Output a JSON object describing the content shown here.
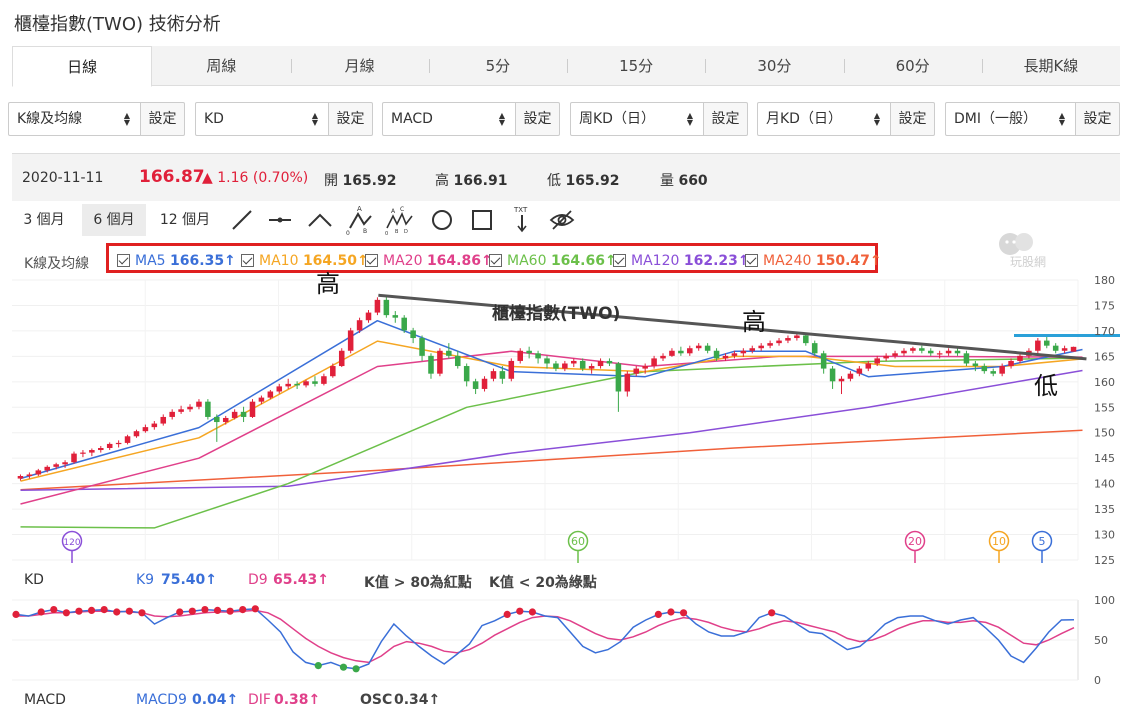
{
  "page_title": "櫃檯指數(TWO) 技術分析",
  "tabs": [
    {
      "label": "日線",
      "active": true
    },
    {
      "label": "周線"
    },
    {
      "label": "月線"
    },
    {
      "label": "5分"
    },
    {
      "label": "15分"
    },
    {
      "label": "30分"
    },
    {
      "label": "60分"
    },
    {
      "label": "長期K線"
    }
  ],
  "selects": [
    {
      "value": "K線及均線",
      "button": "設定"
    },
    {
      "value": "KD",
      "button": "設定"
    },
    {
      "value": "MACD",
      "button": "設定"
    },
    {
      "value": "周KD（日）",
      "button": "設定"
    },
    {
      "value": "月KD（日）",
      "button": "設定"
    },
    {
      "value": "DMI（一般）",
      "button": "設定"
    }
  ],
  "quote": {
    "date": "2020-11-11",
    "price": "166.87",
    "change": "1.16 (0.70%)",
    "open_label": "開",
    "open": "165.92",
    "high_label": "高",
    "high": "166.91",
    "low_label": "低",
    "low": "165.92",
    "volume_label": "量",
    "volume": "660"
  },
  "ranges": [
    {
      "label": "3 個月"
    },
    {
      "label": "6 個月",
      "active": true
    },
    {
      "label": "12 個月"
    }
  ],
  "tool_icons": [
    "line-tool-icon",
    "horizontal-line-icon",
    "peak-line-icon",
    "abc-pattern-icon",
    "abcde-pattern-icon",
    "circle-tool-icon",
    "rectangle-tool-icon",
    "text-tool-icon",
    "hide-drawings-icon"
  ],
  "ma_title": "K線及均線",
  "ma_items": [
    {
      "label": "MA5",
      "value": "166.35↑",
      "color": "#3a6fd8"
    },
    {
      "label": "MA10",
      "value": "164.50↑",
      "color": "#f5a623"
    },
    {
      "label": "MA20",
      "value": "164.86↑",
      "color": "#e0408a"
    },
    {
      "label": "MA60",
      "value": "164.66↑",
      "color": "#6cc04a"
    },
    {
      "label": "MA120",
      "value": "162.23↑",
      "color": "#8a4fd8"
    },
    {
      "label": "MA240",
      "value": "150.47↑",
      "color": "#f0603a"
    }
  ],
  "watermark": "玩股網",
  "annotations": {
    "high1": "高",
    "high2": "高",
    "low": "低",
    "trend_label": "櫃檯指數(TWO)"
  },
  "ma_markers": [
    {
      "label": "120",
      "color": "#8a4fd8"
    },
    {
      "label": "60",
      "color": "#6cc04a"
    },
    {
      "label": "20",
      "color": "#e0408a"
    },
    {
      "label": "10",
      "color": "#f5a623"
    },
    {
      "label": "5",
      "color": "#3a6fd8"
    }
  ],
  "kd": {
    "title": "KD",
    "k_label": "K9",
    "k_value": "75.40↑",
    "d_label": "D9",
    "d_value": "65.43↑",
    "note1": "K值 > 80為紅點",
    "note2": "K值 < 20為綠點"
  },
  "macd": {
    "title": "MACD",
    "macd_label": "MACD9",
    "macd_value": "0.04↑",
    "dif_label": "DIF",
    "dif_value": "0.38↑",
    "osc_label": "OSC",
    "osc_value": "0.34↑"
  },
  "colors": {
    "up": "#e0203a",
    "down": "#3aa84a",
    "trend": "#555555",
    "hline": "#2aa0d8"
  },
  "chart_data": [
    {
      "type": "candlestick",
      "title": "K線及均線",
      "ylim": [
        125,
        180
      ],
      "y_ticks": [
        125,
        130,
        135,
        140,
        145,
        150,
        155,
        160,
        165,
        170,
        175,
        180
      ],
      "candles": [
        [
          141.0,
          141.8,
          140.6,
          141.5
        ],
        [
          141.5,
          142.2,
          141.0,
          141.8
        ],
        [
          141.8,
          142.9,
          141.5,
          142.6
        ],
        [
          142.6,
          143.6,
          142.2,
          143.3
        ],
        [
          143.3,
          144.1,
          142.8,
          143.8
        ],
        [
          143.8,
          144.6,
          143.1,
          144.2
        ],
        [
          144.2,
          146.3,
          143.9,
          145.9
        ],
        [
          145.9,
          146.6,
          145.2,
          146.1
        ],
        [
          146.1,
          146.9,
          145.4,
          146.6
        ],
        [
          146.6,
          147.4,
          146.1,
          147.0
        ],
        [
          147.0,
          148.1,
          146.6,
          147.8
        ],
        [
          147.8,
          148.5,
          147.1,
          148.0
        ],
        [
          148.0,
          149.6,
          147.7,
          149.3
        ],
        [
          149.3,
          150.6,
          149.0,
          150.3
        ],
        [
          150.3,
          151.6,
          150.0,
          151.1
        ],
        [
          151.1,
          152.3,
          150.6,
          151.8
        ],
        [
          151.8,
          153.6,
          151.4,
          153.1
        ],
        [
          153.1,
          154.6,
          152.6,
          154.1
        ],
        [
          154.1,
          155.3,
          153.7,
          154.6
        ],
        [
          154.6,
          155.6,
          154.1,
          155.1
        ],
        [
          155.1,
          156.6,
          154.6,
          156.1
        ],
        [
          156.1,
          156.6,
          152.6,
          153.1
        ],
        [
          153.1,
          153.6,
          148.2,
          152.1
        ],
        [
          152.1,
          153.3,
          151.6,
          152.9
        ],
        [
          152.9,
          154.6,
          152.6,
          154.1
        ],
        [
          154.1,
          155.1,
          152.1,
          153.1
        ],
        [
          153.1,
          156.6,
          152.9,
          156.1
        ],
        [
          156.1,
          157.3,
          155.6,
          156.9
        ],
        [
          156.9,
          158.4,
          156.6,
          158.1
        ],
        [
          158.1,
          159.6,
          157.7,
          159.1
        ],
        [
          159.1,
          160.6,
          158.6,
          159.6
        ],
        [
          159.6,
          160.1,
          158.6,
          159.3
        ],
        [
          159.3,
          160.4,
          158.9,
          160.1
        ],
        [
          160.1,
          161.1,
          159.1,
          159.6
        ],
        [
          159.6,
          161.6,
          159.3,
          161.1
        ],
        [
          161.1,
          163.6,
          160.8,
          163.1
        ],
        [
          163.1,
          166.6,
          162.9,
          166.1
        ],
        [
          166.1,
          170.6,
          165.6,
          170.1
        ],
        [
          170.1,
          172.6,
          169.6,
          172.1
        ],
        [
          172.1,
          174.1,
          171.6,
          173.6
        ],
        [
          173.6,
          176.6,
          173.1,
          176.1
        ],
        [
          176.1,
          176.9,
          172.6,
          173.1
        ],
        [
          173.1,
          173.9,
          171.6,
          172.6
        ],
        [
          172.6,
          173.1,
          169.6,
          170.1
        ],
        [
          170.1,
          170.6,
          167.6,
          168.6
        ],
        [
          168.6,
          169.1,
          164.1,
          165.1
        ],
        [
          165.1,
          165.6,
          160.6,
          161.6
        ],
        [
          161.6,
          166.6,
          161.1,
          166.1
        ],
        [
          166.1,
          167.6,
          164.6,
          165.1
        ],
        [
          165.1,
          166.1,
          162.6,
          163.1
        ],
        [
          163.1,
          163.6,
          159.1,
          160.1
        ],
        [
          160.1,
          160.6,
          157.6,
          158.6
        ],
        [
          158.6,
          161.1,
          158.1,
          160.6
        ],
        [
          160.6,
          162.6,
          160.1,
          162.1
        ],
        [
          162.1,
          163.1,
          159.6,
          160.6
        ],
        [
          160.6,
          164.6,
          160.1,
          164.1
        ],
        [
          164.1,
          166.6,
          163.6,
          166.1
        ],
        [
          166.1,
          166.9,
          164.6,
          165.6
        ],
        [
          165.6,
          166.1,
          163.6,
          164.6
        ],
        [
          164.6,
          165.1,
          162.6,
          163.6
        ],
        [
          163.6,
          164.1,
          162.1,
          162.6
        ],
        [
          162.6,
          164.1,
          162.1,
          163.6
        ],
        [
          163.6,
          164.6,
          162.9,
          164.1
        ],
        [
          164.1,
          164.6,
          162.1,
          162.6
        ],
        [
          162.6,
          163.6,
          161.6,
          163.1
        ],
        [
          163.1,
          164.6,
          162.6,
          164.1
        ],
        [
          164.1,
          164.6,
          163.1,
          163.6
        ],
        [
          163.6,
          163.9,
          154.1,
          158.1
        ],
        [
          158.1,
          162.1,
          157.1,
          161.6
        ],
        [
          161.6,
          163.1,
          161.1,
          162.6
        ],
        [
          162.6,
          163.6,
          161.6,
          163.1
        ],
        [
          163.1,
          165.1,
          162.6,
          164.6
        ],
        [
          164.6,
          165.6,
          164.1,
          165.1
        ],
        [
          165.1,
          166.6,
          164.9,
          166.1
        ],
        [
          166.1,
          166.9,
          165.1,
          165.6
        ],
        [
          165.6,
          167.1,
          165.1,
          166.6
        ],
        [
          166.6,
          167.6,
          166.1,
          167.1
        ],
        [
          167.1,
          167.6,
          165.6,
          166.1
        ],
        [
          166.1,
          166.6,
          164.1,
          164.6
        ],
        [
          164.6,
          165.6,
          164.1,
          165.1
        ],
        [
          165.1,
          166.1,
          164.6,
          165.6
        ],
        [
          165.6,
          166.6,
          164.9,
          166.1
        ],
        [
          166.1,
          167.1,
          165.6,
          166.6
        ],
        [
          166.6,
          167.6,
          166.1,
          167.1
        ],
        [
          167.1,
          168.1,
          166.6,
          167.6
        ],
        [
          167.6,
          168.6,
          167.1,
          168.1
        ],
        [
          168.1,
          169.1,
          167.6,
          168.6
        ],
        [
          168.6,
          169.6,
          168.1,
          169.1
        ],
        [
          169.1,
          169.3,
          167.1,
          167.6
        ],
        [
          167.6,
          168.1,
          165.1,
          165.6
        ],
        [
          165.6,
          166.1,
          161.6,
          162.6
        ],
        [
          162.6,
          163.1,
          158.6,
          160.1
        ],
        [
          160.1,
          161.1,
          157.6,
          160.6
        ],
        [
          160.6,
          162.1,
          160.1,
          161.6
        ],
        [
          161.6,
          163.1,
          161.1,
          162.6
        ],
        [
          162.6,
          164.1,
          162.1,
          163.6
        ],
        [
          163.6,
          165.1,
          163.1,
          164.6
        ],
        [
          164.6,
          165.6,
          164.1,
          165.1
        ],
        [
          165.1,
          166.1,
          164.6,
          165.6
        ],
        [
          165.6,
          166.6,
          165.1,
          166.1
        ],
        [
          166.1,
          166.9,
          165.6,
          166.6
        ],
        [
          166.6,
          167.1,
          165.6,
          166.1
        ],
        [
          166.1,
          166.6,
          165.1,
          165.6
        ],
        [
          165.6,
          166.1,
          164.6,
          165.6
        ],
        [
          165.6,
          166.6,
          165.1,
          166.1
        ],
        [
          166.1,
          166.6,
          165.1,
          165.6
        ],
        [
          165.6,
          166.1,
          163.1,
          163.6
        ],
        [
          163.6,
          164.1,
          162.1,
          163.1
        ],
        [
          163.1,
          163.6,
          161.6,
          162.1
        ],
        [
          162.1,
          162.6,
          161.1,
          161.6
        ],
        [
          161.6,
          163.6,
          161.1,
          163.1
        ],
        [
          163.1,
          164.6,
          162.6,
          164.1
        ],
        [
          164.1,
          165.6,
          163.6,
          165.1
        ],
        [
          165.1,
          166.6,
          164.6,
          166.1
        ],
        [
          166.1,
          168.6,
          165.6,
          168.1
        ],
        [
          168.1,
          168.9,
          166.6,
          167.1
        ],
        [
          167.1,
          167.6,
          165.6,
          166.1
        ],
        [
          166.1,
          167.1,
          165.6,
          166.6
        ],
        [
          165.92,
          166.91,
          165.92,
          166.87
        ]
      ],
      "ma_lines": {
        "MA5": [
          [
            0,
            141
          ],
          [
            20,
            151
          ],
          [
            40,
            172
          ],
          [
            55,
            162
          ],
          [
            70,
            161
          ],
          [
            80,
            166
          ],
          [
            88,
            166
          ],
          [
            95,
            161
          ],
          [
            110,
            163
          ],
          [
            119,
            166.35
          ]
        ],
        "MA10": [
          [
            0,
            140.5
          ],
          [
            20,
            149
          ],
          [
            40,
            168
          ],
          [
            55,
            163
          ],
          [
            70,
            162
          ],
          [
            80,
            165
          ],
          [
            88,
            165
          ],
          [
            98,
            163
          ],
          [
            110,
            163
          ],
          [
            119,
            164.5
          ]
        ],
        "MA20": [
          [
            0,
            136
          ],
          [
            20,
            145
          ],
          [
            40,
            163
          ],
          [
            55,
            166
          ],
          [
            70,
            163
          ],
          [
            85,
            165
          ],
          [
            100,
            165
          ],
          [
            119,
            164.86
          ]
        ],
        "MA60": [
          [
            0,
            131.5
          ],
          [
            15,
            131.3
          ],
          [
            30,
            140
          ],
          [
            50,
            155
          ],
          [
            70,
            162
          ],
          [
            95,
            164
          ],
          [
            119,
            164.66
          ]
        ],
        "MA120": [
          [
            0,
            138.7
          ],
          [
            30,
            139.5
          ],
          [
            55,
            146
          ],
          [
            75,
            150
          ],
          [
            95,
            155
          ],
          [
            119,
            162.23
          ]
        ],
        "MA240": [
          [
            0,
            138.8
          ],
          [
            40,
            142.6
          ],
          [
            80,
            147
          ],
          [
            119,
            150.47
          ]
        ]
      },
      "trendline": [
        [
          41,
          177.0
        ],
        [
          119,
          164.5
        ]
      ],
      "hline": {
        "value": 169.1
      }
    },
    {
      "type": "line",
      "title": "KD",
      "ylim": [
        0,
        100
      ],
      "y_ticks": [
        0,
        50,
        100
      ],
      "series": [
        {
          "name": "K9",
          "color": "#3a6fd8",
          "values": [
            82,
            80,
            85,
            88,
            84,
            86,
            87,
            88,
            85,
            86,
            84,
            70,
            78,
            85,
            86,
            88,
            87,
            86,
            88,
            89,
            75,
            60,
            35,
            22,
            18,
            22,
            16,
            14,
            20,
            48,
            70,
            55,
            42,
            30,
            20,
            32,
            45,
            68,
            74,
            82,
            86,
            85,
            80,
            78,
            60,
            42,
            34,
            38,
            48,
            66,
            75,
            82,
            85,
            84,
            70,
            60,
            55,
            55,
            60,
            78,
            84,
            80,
            70,
            60,
            58,
            48,
            38,
            42,
            55,
            70,
            78,
            80,
            80,
            74,
            70,
            75,
            78,
            65,
            50,
            30,
            22,
            40,
            60,
            75,
            75.4
          ]
        },
        {
          "name": "D9",
          "color": "#e0408a",
          "values": [
            80,
            80,
            82,
            84,
            84,
            85,
            86,
            86,
            86,
            85,
            84,
            80,
            79,
            80,
            82,
            84,
            85,
            85,
            86,
            87,
            84,
            76,
            64,
            52,
            42,
            34,
            28,
            24,
            22,
            30,
            42,
            48,
            46,
            42,
            36,
            34,
            38,
            46,
            56,
            64,
            72,
            78,
            80,
            79,
            74,
            66,
            58,
            52,
            50,
            54,
            60,
            68,
            74,
            78,
            76,
            72,
            66,
            62,
            60,
            64,
            70,
            74,
            72,
            68,
            64,
            60,
            52,
            48,
            50,
            56,
            64,
            70,
            74,
            74,
            72,
            72,
            74,
            72,
            66,
            56,
            46,
            44,
            50,
            58,
            65.43
          ]
        }
      ]
    }
  ]
}
